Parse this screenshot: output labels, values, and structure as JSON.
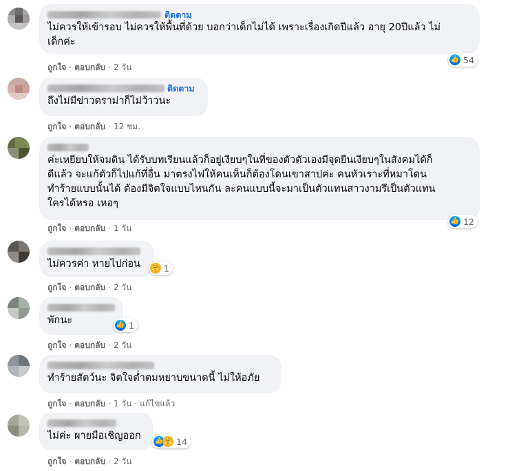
{
  "comments": [
    {
      "follow": "ติดตาม",
      "text": "ไม่ควรให้เข้ารอบ ไม่ควรให้พื้นที่ด้วย บอกว่าเด็กไม่ได้ เพราะเรื่องเกิดปีแล้ว อายุ 20ปีแล้ว ไม่\nเด็กค่ะ",
      "actions": {
        "like": "ถูกใจ",
        "reply": "ตอบกลับ",
        "time": "2 วัน"
      },
      "reaction": {
        "icons": [
          "like-icon"
        ],
        "count": "54"
      }
    },
    {
      "follow": "ติดตาม",
      "text": "ถึงไม่มีข่าวดราม่าก็ไม่ว้าวนะ",
      "actions": {
        "like": "ถูกใจ",
        "reply": "ตอบกลับ",
        "time": "12 ชม."
      }
    },
    {
      "text": "ค่ะเหยียบให้จมดิน ได้รับบทเรียนแล้วก็อยู่เงียบๆในที่ของตัวตัวเองมีจุดยืนเงียบๆในสังคมได้ก็\nดีแล้ว จะแก้ตัวก็ไปแก้ที่อื่น มาตรงไฟให้คนเห็นก็ต้องโดนเขาสาปค่ะ คนหัวเราะที่หมาโดน\nทำร้ายแบบนั้นได้ ต้องมีจิตใจแบบไหนกัน ละคนแบบนี้จะมาเป็นตัวแทนสาวงามรึเป็นตัวแทน\nใครได้หรอ เหอๆ",
      "actions": {
        "like": "ถูกใจ",
        "reply": "ตอบกลับ",
        "time": "1 วัน"
      },
      "reaction": {
        "icons": [
          "like-icon"
        ],
        "count": "12"
      }
    },
    {
      "text": "ไม่ควรค่า หายไปก่อน",
      "actions": {
        "like": "ถูกใจ",
        "reply": "ตอบกลับ",
        "time": "2 วัน"
      },
      "reaction": {
        "icons": [
          "care-icon"
        ],
        "count": "1"
      }
    },
    {
      "text": "พักนะ",
      "actions": {
        "like": "ถูกใจ",
        "reply": "ตอบกลับ",
        "time": "2 วัน"
      },
      "reaction": {
        "icons": [
          "like-icon"
        ],
        "count": "1"
      }
    },
    {
      "text": "ทำร้ายสัตว์นะ จิตใจต่ำตมหยาบขนาดนี้ ไม่ให้อภัย",
      "actions": {
        "like": "ถูกใจ",
        "reply": "ตอบกลับ",
        "time": "1 วัน",
        "edited": "แก้ไขแล้ว"
      }
    },
    {
      "text": "ไม่ค่ะ ผายมือเชิญออก",
      "actions": {
        "like": "ถูกใจ",
        "reply": "ตอบกลับ",
        "time": "2 วัน"
      },
      "reaction": {
        "icons": [
          "like-icon",
          "care-icon"
        ],
        "count": "14"
      }
    }
  ],
  "colors": {
    "bubble": "#f0f2f5",
    "link": "#216fdb",
    "meta": "#65676b",
    "like": "#1877f2"
  }
}
